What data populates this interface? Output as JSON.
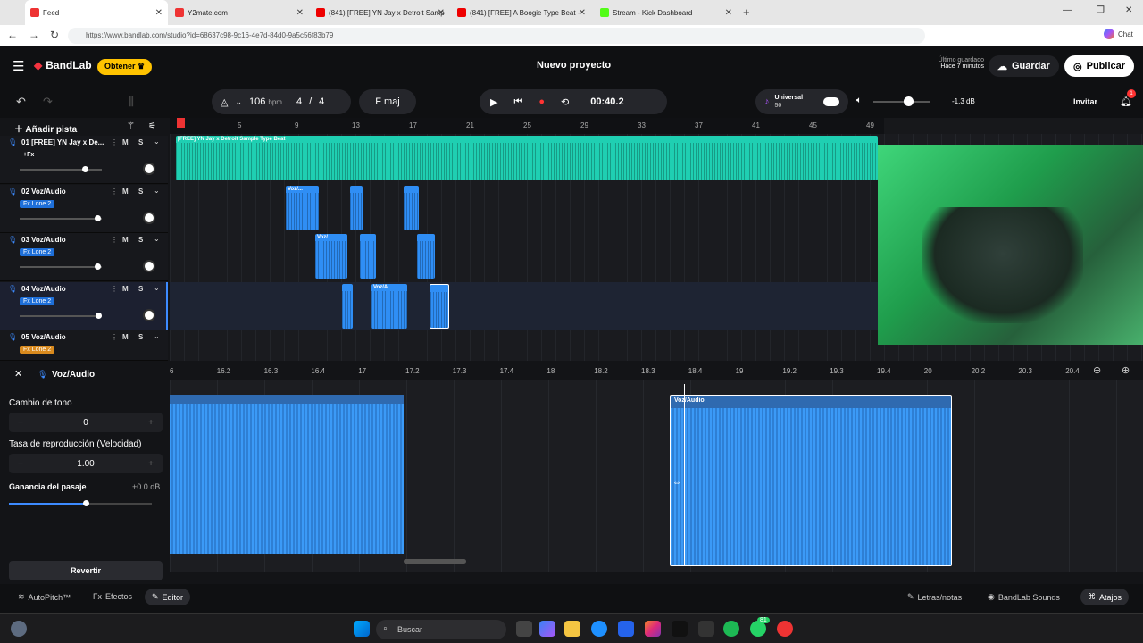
{
  "browser": {
    "tabs": [
      {
        "label": "Feed",
        "color": "#e33"
      },
      {
        "label": "Y2mate.com",
        "color": "#e33"
      },
      {
        "label": "(841) [FREE] YN Jay x Detroit Samp",
        "color": "#e00"
      },
      {
        "label": "(841) [FREE] A Boogie Type Beat -",
        "color": "#e00"
      },
      {
        "label": "Stream - Kick Dashboard",
        "color": "#53fc18"
      }
    ],
    "url": "https://www.bandlab.com/studio?id=68637c98-9c16-4e7d-84d0-9a5c56f83b79",
    "chat_label": "Chat"
  },
  "app": {
    "brand": "BandLab",
    "get_label": "Obtener",
    "project_title": "Nuevo proyecto",
    "save_status_line1": "Último guardado",
    "save_status_line2": "Hace 7 minutos",
    "save_label": "Guardar",
    "publish_label": "Publicar",
    "invite_label": "Invitar",
    "notification_count": "1",
    "bpm": "106",
    "bpm_unit": "bpm",
    "time_sig_num": "4",
    "time_sig_sep": "/",
    "time_sig_den": "4",
    "key": "F maj",
    "time": "00:40.2",
    "universal_label": "Universal",
    "universal_value": "50",
    "volume_db": "-1.3 dB",
    "add_track_label": "Añadir pista"
  },
  "ruler": [
    "1",
    "5",
    "9",
    "13",
    "17",
    "21",
    "25",
    "29",
    "33",
    "37",
    "41",
    "45",
    "49"
  ],
  "tracks": [
    {
      "name": "01  [FREE] YN Jay x De...",
      "fx": "+Fx",
      "fx_style": "plain",
      "mute": "M",
      "solo": "S",
      "volume": 0.8
    },
    {
      "name": "02  Voz/Audio",
      "fx": "Fx Lone 2",
      "fx_style": "blue",
      "mute": "M",
      "solo": "S",
      "volume": 0.95
    },
    {
      "name": "03  Voz/Audio",
      "fx": "Fx Lone 2",
      "fx_style": "blue",
      "mute": "M",
      "solo": "S",
      "volume": 0.95
    },
    {
      "name": "04  Voz/Audio",
      "fx": "Fx Lone 2",
      "fx_style": "blue",
      "mute": "M",
      "solo": "S",
      "volume": 0.97
    },
    {
      "name": "05  Voz/Audio",
      "fx": "Fx Lone 2",
      "fx_style": "orange",
      "mute": "M",
      "solo": "S",
      "volume": 0.95
    }
  ],
  "clips": {
    "beat_label": "[FREE] YN Jay x Detroit Sample Type Beat",
    "voz_short": "Voz/...",
    "voz_mid": "Voz/A..."
  },
  "editor": {
    "title": "Voz/Audio",
    "pitch_label": "Cambio de tono",
    "pitch_value": "0",
    "rate_label": "Tasa de reproducción (Velocidad)",
    "rate_value": "1.00",
    "gain_label": "Ganancia del pasaje",
    "gain_value": "+0.0 dB",
    "gain_level": 0.5,
    "revert_label": "Revertir",
    "clip_label": "Voz/Audio",
    "ruler": [
      "6",
      "16.2",
      "16.3",
      "16.4",
      "17",
      "17.2",
      "17.3",
      "17.4",
      "18",
      "18.2",
      "18.3",
      "18.4",
      "19",
      "19.2",
      "19.3",
      "19.4",
      "20",
      "20.2",
      "20.3",
      "20.4"
    ]
  },
  "bottom": {
    "autopitch": "AutoPitch™",
    "effects": "Efectos",
    "editor": "Editor",
    "lyrics": "Letras/notas",
    "sounds": "BandLab Sounds",
    "shortcuts": "Atajos"
  },
  "taskbar": {
    "search_placeholder": "Buscar",
    "badge": "81"
  }
}
